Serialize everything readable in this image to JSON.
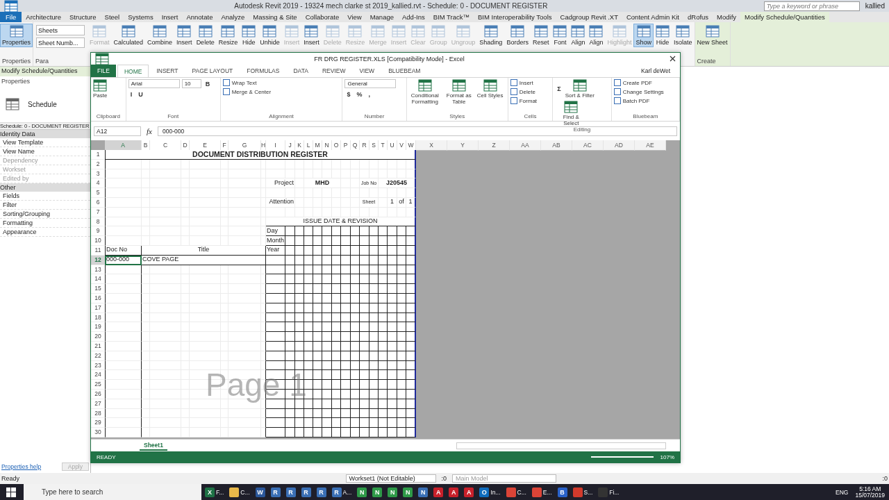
{
  "revit": {
    "title": "Autodesk Revit 2019 - 19324 mech clarke st 2019_kallied.rvt - Schedule: 0 - DOCUMENT REGISTER",
    "search": {
      "placeholder": "Type a keyword or phrase"
    },
    "user": "kallied",
    "tabs": [
      {
        "label": "File",
        "kind": "file",
        "selected": false
      },
      {
        "label": "Architecture",
        "kind": "tab",
        "selected": false
      },
      {
        "label": "Structure",
        "kind": "tab",
        "selected": false
      },
      {
        "label": "Steel",
        "kind": "tab",
        "selected": false
      },
      {
        "label": "Systems",
        "kind": "tab",
        "selected": false
      },
      {
        "label": "Insert",
        "kind": "tab",
        "selected": false
      },
      {
        "label": "Annotate",
        "kind": "tab",
        "selected": false
      },
      {
        "label": "Analyze",
        "kind": "tab",
        "selected": false
      },
      {
        "label": "Massing & Site",
        "kind": "tab",
        "selected": false
      },
      {
        "label": "Collaborate",
        "kind": "tab",
        "selected": false
      },
      {
        "label": "View",
        "kind": "tab",
        "selected": false
      },
      {
        "label": "Manage",
        "kind": "tab",
        "selected": false
      },
      {
        "label": "Add-Ins",
        "kind": "tab",
        "selected": false
      },
      {
        "label": "BIM Track™",
        "kind": "tab",
        "selected": false
      },
      {
        "label": "BIM Interoperability Tools",
        "kind": "tab",
        "selected": false
      },
      {
        "label": "Cadgroup Revit .XT",
        "kind": "tab",
        "selected": false
      },
      {
        "label": "Content Admin Kit",
        "kind": "tab",
        "selected": false
      },
      {
        "label": "dRofus",
        "kind": "tab",
        "selected": false
      },
      {
        "label": "Modify",
        "kind": "tab",
        "selected": false
      },
      {
        "label": "Modify Schedule/Quantities",
        "kind": "tab",
        "selected": true
      }
    ],
    "panels": [
      {
        "label": "Properties",
        "items": [
          {
            "kind": "button",
            "label": "Properties",
            "disabled": false,
            "selected": true
          }
        ]
      },
      {
        "label": "Para",
        "items": [
          {
            "kind": "dropdowns",
            "options": [
              "Sheets",
              "Sheet Numb..."
            ]
          },
          {
            "kind": "button",
            "label": "Format",
            "disabled": true,
            "selected": false
          },
          {
            "kind": "button",
            "label": "Calculated",
            "disabled": false,
            "selected": false
          },
          {
            "kind": "button",
            "label": "Combine",
            "disabled": false,
            "selected": false
          },
          {
            "kind": "button",
            "label": "Insert",
            "disabled": false,
            "selected": false
          },
          {
            "kind": "button",
            "label": "Delete",
            "disabled": false,
            "selected": false
          },
          {
            "kind": "button",
            "label": "Resize",
            "disabled": false,
            "selected": false
          },
          {
            "kind": "button",
            "label": "Hide",
            "disabled": false,
            "selected": false
          },
          {
            "kind": "button",
            "label": "Unhide",
            "disabled": false,
            "selected": false
          },
          {
            "kind": "button",
            "label": "Insert",
            "disabled": true,
            "selected": false
          },
          {
            "kind": "button",
            "label": "Insert",
            "disabled": false,
            "selected": false
          },
          {
            "kind": "button",
            "label": "Delete",
            "disabled": true,
            "selected": false
          },
          {
            "kind": "button",
            "label": "Resize",
            "disabled": true,
            "selected": false
          },
          {
            "kind": "button",
            "label": "Merge",
            "disabled": true,
            "selected": false
          },
          {
            "kind": "button",
            "label": "Insert",
            "disabled": true,
            "selected": false
          },
          {
            "kind": "button",
            "label": "Clear",
            "disabled": true,
            "selected": false
          },
          {
            "kind": "button",
            "label": "Group",
            "disabled": true,
            "selected": false
          },
          {
            "kind": "button",
            "label": "Ungroup",
            "disabled": true,
            "selected": false
          },
          {
            "kind": "button",
            "label": "Shading",
            "disabled": false,
            "selected": false
          },
          {
            "kind": "button",
            "label": "Borders",
            "disabled": false,
            "selected": false
          },
          {
            "kind": "button",
            "label": "Reset",
            "disabled": false,
            "selected": false
          },
          {
            "kind": "button",
            "label": "Font",
            "disabled": false,
            "selected": false
          },
          {
            "kind": "button",
            "label": "Align",
            "disabled": false,
            "selected": false
          },
          {
            "kind": "button",
            "label": "Align",
            "disabled": false,
            "selected": false
          },
          {
            "kind": "button",
            "label": "Highlight",
            "disabled": true,
            "selected": false
          },
          {
            "kind": "button",
            "label": "Show",
            "disabled": false,
            "selected": true
          },
          {
            "kind": "button",
            "label": "Hide",
            "disabled": false,
            "selected": false
          },
          {
            "kind": "button",
            "label": "Isolate",
            "disabled": false,
            "selected": false
          }
        ]
      },
      {
        "label": "Create",
        "items": [
          {
            "kind": "button",
            "label": "New Sheet",
            "disabled": false,
            "selected": false
          }
        ]
      }
    ],
    "context_label": "Modify Schedule/Quantities",
    "properties": {
      "title": "Properties",
      "type_name": "Schedule",
      "selector": "Schedule: 0 - DOCUMENT REGISTER",
      "groups": [
        {
          "label": "Identity Data",
          "items": [
            {
              "label": "View Template",
              "disabled": false
            },
            {
              "label": "View Name",
              "disabled": false
            },
            {
              "label": "Dependency",
              "disabled": true
            },
            {
              "label": "Workset",
              "disabled": true
            },
            {
              "label": "Edited by",
              "disabled": true
            }
          ]
        },
        {
          "label": "Other",
          "items": [
            {
              "label": "Fields",
              "disabled": false
            },
            {
              "label": "Filter",
              "disabled": false
            },
            {
              "label": "Sorting/Grouping",
              "disabled": false
            },
            {
              "label": "Formatting",
              "disabled": false
            },
            {
              "label": "Appearance",
              "disabled": false
            }
          ]
        }
      ],
      "help": "Properties help",
      "apply": "Apply"
    },
    "status": {
      "text": "Ready",
      "workset": "Workset1 (Not Editable)",
      "count": ":0",
      "model": "Main Model",
      "filter_count": ":0"
    }
  },
  "excel": {
    "title": "FR DRG REGISTER.XLS  [Compatibility Mode] - Excel",
    "user": "Karl deWet",
    "tabs": [
      {
        "label": "FILE",
        "kind": "file",
        "selected": false
      },
      {
        "label": "HOME",
        "kind": "tab",
        "selected": true
      },
      {
        "label": "INSERT",
        "kind": "tab",
        "selected": false
      },
      {
        "label": "PAGE LAYOUT",
        "kind": "tab",
        "selected": false
      },
      {
        "label": "FORMULAS",
        "kind": "tab",
        "selected": false
      },
      {
        "label": "DATA",
        "kind": "tab",
        "selected": false
      },
      {
        "label": "REVIEW",
        "kind": "tab",
        "selected": false
      },
      {
        "label": "VIEW",
        "kind": "tab",
        "selected": false
      },
      {
        "label": "BLUEBEAM",
        "kind": "tab",
        "selected": false
      }
    ],
    "groups": [
      {
        "label": "Clipboard",
        "items": [
          {
            "kind": "big",
            "label": "Paste"
          }
        ]
      },
      {
        "label": "Font",
        "items": [
          {
            "kind": "field",
            "value": "Arial"
          },
          {
            "kind": "field",
            "value": "10"
          },
          {
            "kind": "glyph",
            "label": "B"
          },
          {
            "kind": "glyph",
            "label": "I"
          },
          {
            "kind": "glyph",
            "label": "U"
          }
        ]
      },
      {
        "label": "Alignment",
        "items": [
          {
            "kind": "small",
            "label": "Wrap Text"
          },
          {
            "kind": "small",
            "label": "Merge & Center"
          }
        ]
      },
      {
        "label": "Number",
        "items": [
          {
            "kind": "field",
            "value": "General"
          },
          {
            "kind": "glyph",
            "label": "$"
          },
          {
            "kind": "glyph",
            "label": "%"
          },
          {
            "kind": "glyph",
            "label": ","
          }
        ]
      },
      {
        "label": "Styles",
        "items": [
          {
            "kind": "big",
            "label": "Conditional Formatting"
          },
          {
            "kind": "big",
            "label": "Format as Table"
          },
          {
            "kind": "big",
            "label": "Cell Styles"
          }
        ]
      },
      {
        "label": "Cells",
        "items": [
          {
            "kind": "small",
            "label": "Insert"
          },
          {
            "kind": "small",
            "label": "Delete"
          },
          {
            "kind": "small",
            "label": "Format"
          }
        ]
      },
      {
        "label": "Editing",
        "items": [
          {
            "kind": "glyph",
            "label": "Σ"
          },
          {
            "kind": "big",
            "label": "Sort & Filter"
          },
          {
            "kind": "big",
            "label": "Find & Select"
          }
        ]
      },
      {
        "label": "Bluebeam",
        "items": [
          {
            "kind": "small",
            "label": "Create PDF"
          },
          {
            "kind": "small",
            "label": "Change Settings"
          },
          {
            "kind": "small",
            "label": "Batch PDF"
          }
        ]
      }
    ],
    "name_box": "A12",
    "function_label": "fx",
    "formula": "000-000",
    "columns": [
      {
        "label": "A",
        "selected": true
      },
      {
        "label": "B",
        "selected": false
      },
      {
        "label": "C",
        "selected": false
      },
      {
        "label": "D",
        "selected": false
      },
      {
        "label": "E",
        "selected": false
      },
      {
        "label": "F",
        "selected": false
      },
      {
        "label": "G",
        "selected": false
      },
      {
        "label": "H",
        "selected": false
      },
      {
        "label": "I",
        "selected": false
      },
      {
        "label": "J",
        "selected": false
      },
      {
        "label": "K",
        "selected": false
      },
      {
        "label": "L",
        "selected": false
      },
      {
        "label": "M",
        "selected": false
      },
      {
        "label": "N",
        "selected": false
      },
      {
        "label": "O",
        "selected": false
      },
      {
        "label": "P",
        "selected": false
      },
      {
        "label": "Q",
        "selected": false
      },
      {
        "label": "R",
        "selected": false
      },
      {
        "label": "S",
        "selected": false
      },
      {
        "label": "T",
        "selected": false
      },
      {
        "label": "U",
        "selected": false
      },
      {
        "label": "V",
        "selected": false
      },
      {
        "label": "W",
        "selected": false
      }
    ],
    "outside_columns": [
      "X",
      "Y",
      "Z",
      "AA",
      "AB",
      "AC",
      "AD",
      "AE"
    ],
    "rows": [
      {
        "label": "1",
        "selected": false
      },
      {
        "label": "2",
        "selected": false
      },
      {
        "label": "3",
        "selected": false
      },
      {
        "label": "4",
        "selected": false
      },
      {
        "label": "5",
        "selected": false
      },
      {
        "label": "6",
        "selected": false
      },
      {
        "label": "7",
        "selected": false
      },
      {
        "label": "8",
        "selected": false
      },
      {
        "label": "9",
        "selected": false
      },
      {
        "label": "10",
        "selected": false
      },
      {
        "label": "11",
        "selected": false
      },
      {
        "label": "12",
        "selected": true
      },
      {
        "label": "13",
        "selected": false
      },
      {
        "label": "14",
        "selected": false
      },
      {
        "label": "15",
        "selected": false
      },
      {
        "label": "16",
        "selected": false
      },
      {
        "label": "17",
        "selected": false
      },
      {
        "label": "18",
        "selected": false
      },
      {
        "label": "19",
        "selected": false
      },
      {
        "label": "20",
        "selected": false
      },
      {
        "label": "21",
        "selected": false
      },
      {
        "label": "22",
        "selected": false
      },
      {
        "label": "23",
        "selected": false
      },
      {
        "label": "24",
        "selected": false
      },
      {
        "label": "25",
        "selected": false
      },
      {
        "label": "26",
        "selected": false
      },
      {
        "label": "27",
        "selected": false
      },
      {
        "label": "28",
        "selected": false
      },
      {
        "label": "29",
        "selected": false
      },
      {
        "label": "30",
        "selected": false
      }
    ],
    "register": {
      "title": "DOCUMENT DISTRIBUTION REGISTER",
      "project_label": "Project",
      "project": "MHD",
      "job_label": "Job No",
      "job": "J20545",
      "attention_label": "Attention",
      "sheet_label": "Sheet",
      "sheet_no": "1",
      "of": "of",
      "sheet_total": "1",
      "issue_heading": "ISSUE DATE & REVISION",
      "day": "Day",
      "month": "Month",
      "year": "Year",
      "doc_no_heading": "Doc No",
      "title_heading": "Title",
      "doc_no": "000-000",
      "doc_title": "COVE PAGE"
    },
    "page_label": "Page 1",
    "sheet_tab": "Sheet1",
    "status": "READY",
    "zoom": "107%"
  },
  "taskbar": {
    "search": {
      "placeholder": "Type here to search"
    },
    "apps": [
      {
        "glyph": "X",
        "label": "F...",
        "color": "#1e7145"
      },
      {
        "label": "C...",
        "color": "#e8b84a"
      },
      {
        "glyph": "W",
        "color": "#2b579a"
      },
      {
        "glyph": "R",
        "color": "#3a6fb5"
      },
      {
        "glyph": "R",
        "color": "#3a6fb5"
      },
      {
        "glyph": "R",
        "color": "#3a6fb5"
      },
      {
        "glyph": "R",
        "color": "#3a6fb5"
      },
      {
        "glyph": "R",
        "label": "A...",
        "color": "#3a6fb5"
      },
      {
        "glyph": "N",
        "color": "#2e9a48"
      },
      {
        "glyph": "N",
        "color": "#2e9a48"
      },
      {
        "glyph": "N",
        "color": "#2e9a48"
      },
      {
        "glyph": "N",
        "color": "#2e9a48"
      },
      {
        "glyph": "N",
        "color": "#3a6fb5"
      },
      {
        "glyph": "A",
        "color": "#c8202a"
      },
      {
        "glyph": "A",
        "color": "#c8202a"
      },
      {
        "glyph": "A",
        "color": "#c8202a"
      },
      {
        "glyph": "O",
        "label": "In...",
        "color": "#0f6cbd"
      },
      {
        "label": "C...",
        "color": "#db4437"
      },
      {
        "label": "E...",
        "color": "#db4437"
      },
      {
        "glyph": "B",
        "color": "#2a62c9"
      },
      {
        "label": "S...",
        "color": "#d13a2c"
      },
      {
        "label": "Fi...",
        "color": "#333333"
      }
    ],
    "language": "ENG",
    "time": "5:16 AM",
    "date": "15/07/2019"
  }
}
